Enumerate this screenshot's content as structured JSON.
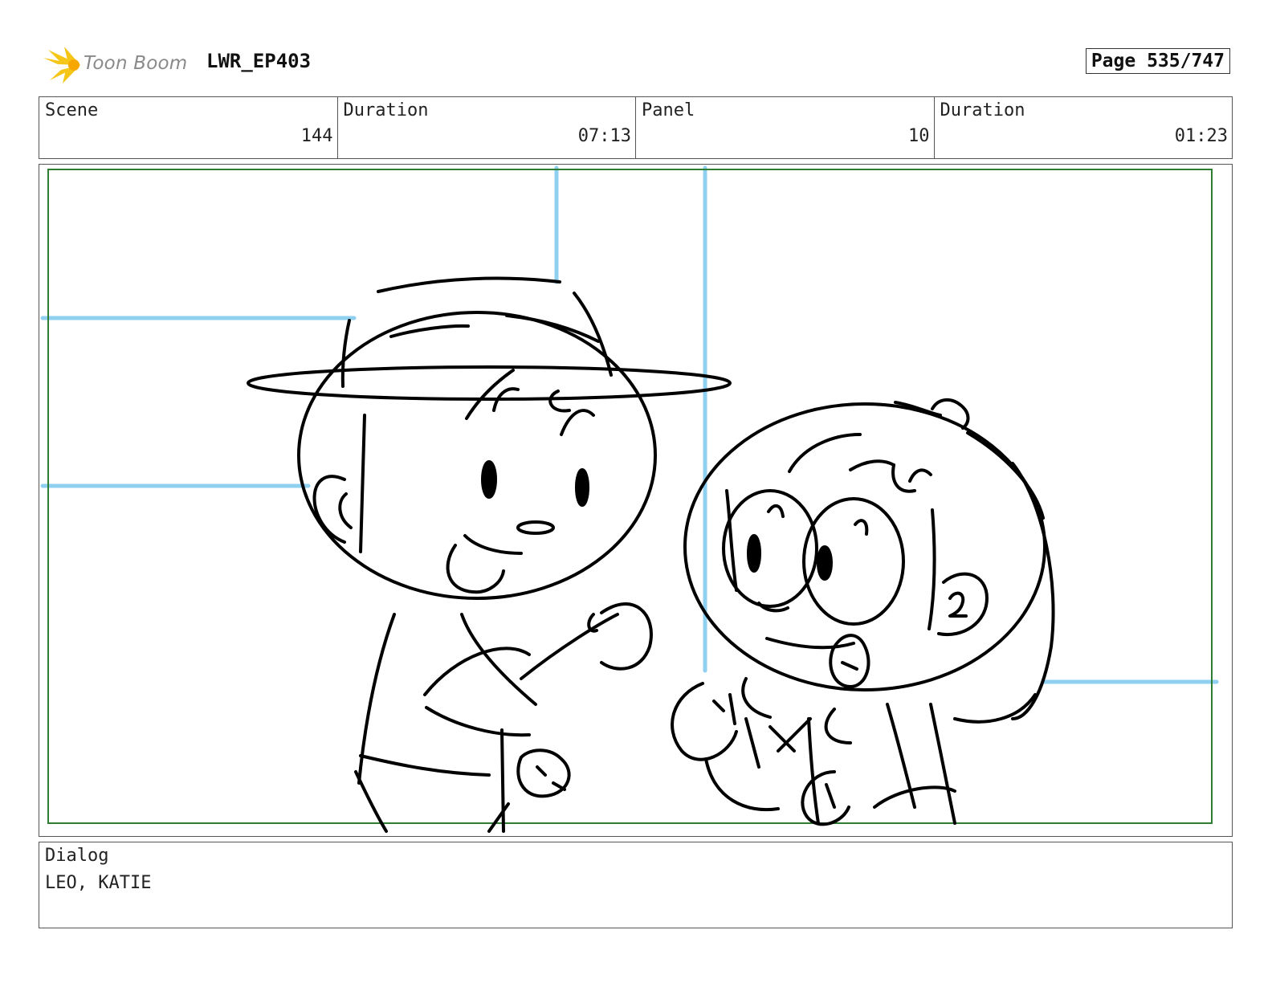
{
  "header": {
    "logo_text": "Toon Boom",
    "project": "LWR_EP403",
    "page": "Page 535/747"
  },
  "info": {
    "scene_label": "Scene",
    "scene_value": "144",
    "scene_duration_label": "Duration",
    "scene_duration_value": "07:13",
    "panel_label": "Panel",
    "panel_value": "10",
    "panel_duration_label": "Duration",
    "panel_duration_value": "01:23"
  },
  "dialog": {
    "label": "Dialog",
    "text": "LEO, KATIE"
  },
  "colors": {
    "safe_frame": "#2e7d32",
    "layout_lines": "#8fd0f0",
    "logo_flame": "#f5c518",
    "ink": "#000000"
  }
}
